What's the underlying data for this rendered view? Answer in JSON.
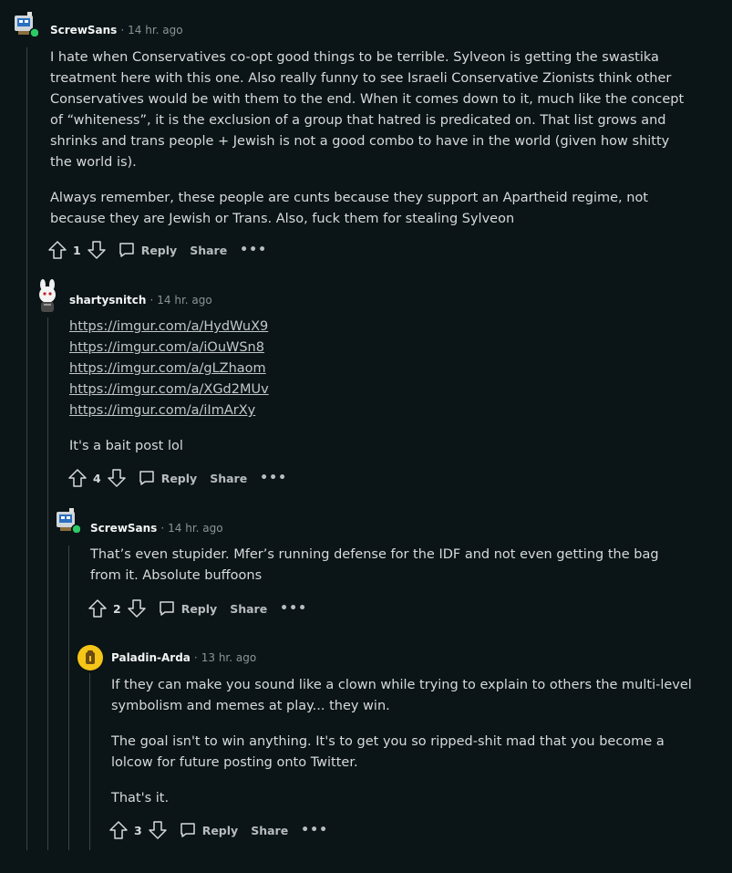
{
  "comments": [
    {
      "author": "ScrewSans",
      "time": "14 hr. ago",
      "paragraphs": [
        "I hate when Conservatives co-opt good things to be terrible. Sylveon is getting the swastika treatment here with this one. Also really funny to see Israeli Conservative Zionists think other Conservatives would be with them to the end. When it comes down to it, much like the concept of “whiteness”, it is the exclusion of a group that hatred is predicated on. That list grows and shrinks and trans people + Jewish is not a good combo to have in the world (given how shitty the world is).",
        "Always remember, these people are cunts because they support an Apartheid regime, not because they are Jewish or Trans. Also, fuck them for stealing Sylveon"
      ],
      "score": "1",
      "reply_label": "Reply",
      "share_label": "Share",
      "more_label": "•••"
    },
    {
      "author": "shartysnitch",
      "time": "14 hr. ago",
      "links": [
        "https://imgur.com/a/HydWuX9",
        "https://imgur.com/a/iOuWSn8",
        "https://imgur.com/a/gLZhaom",
        "https://imgur.com/a/XGd2MUv",
        "https://imgur.com/a/iImArXy"
      ],
      "paragraphs": [
        "It's a bait post lol"
      ],
      "score": "4",
      "reply_label": "Reply",
      "share_label": "Share",
      "more_label": "•••"
    },
    {
      "author": "ScrewSans",
      "time": "14 hr. ago",
      "paragraphs": [
        "That’s even stupider. Mfer’s running defense for the IDF and not even getting the bag from it. Absolute buffoons"
      ],
      "score": "2",
      "reply_label": "Reply",
      "share_label": "Share",
      "more_label": "•••"
    },
    {
      "author": "Paladin-Arda",
      "time": "13 hr. ago",
      "paragraphs": [
        "If they can make you sound like a clown while trying to explain to others the multi-level symbolism and memes at play... they win.",
        "The goal isn't to win anything. It's to get you so ripped-shit mad that you become a lolcow for future posting onto Twitter.",
        "That's it."
      ],
      "score": "3",
      "reply_label": "Reply",
      "share_label": "Share",
      "more_label": "•••"
    }
  ],
  "colors": {
    "background": "#0b1416",
    "online_indicator": "#2ec866",
    "avatar_yellow": "#f5c518"
  }
}
